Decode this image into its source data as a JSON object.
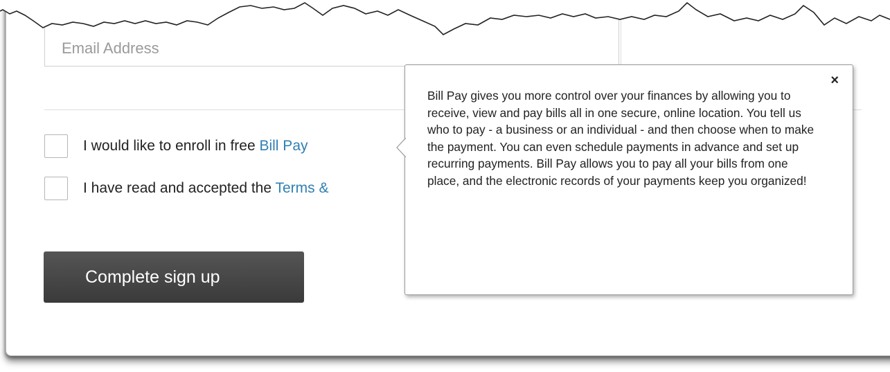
{
  "signup_form": {
    "email": {
      "placeholder": "Email Address",
      "value": ""
    },
    "checkboxes": [
      {
        "label_prefix": "I would like to enroll in free ",
        "link_text": "Bill Pay",
        "checked": false
      },
      {
        "label_prefix": "I have read and accepted the ",
        "link_text": "Terms &",
        "checked": false
      }
    ],
    "submit_label": "Complete sign up"
  },
  "bill_pay_popover": {
    "close_glyph": "×",
    "body": "Bill Pay gives you more control over your finances by allowing you to receive, view and pay bills all in one secure, online location. You tell us who to pay - a business or an individual - and then choose when to make the payment. You can even schedule payments in advance and set up recurring payments. Bill Pay allows you to pay all your bills from one place, and the electronic records of your payments keep you organized!"
  },
  "colors": {
    "link": "#2f7fb3",
    "button_bg": "#444444",
    "button_text": "#ffffff"
  },
  "icons": {
    "close": "close-icon",
    "popover_pointer": "popover-arrow"
  }
}
